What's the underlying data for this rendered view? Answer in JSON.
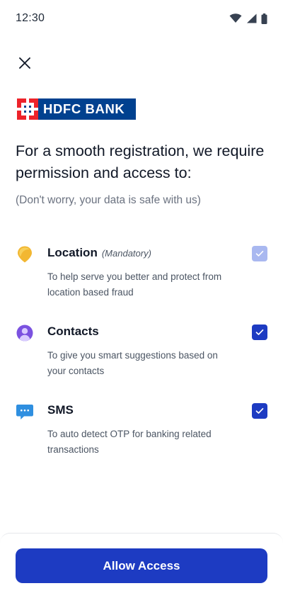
{
  "status_bar": {
    "time": "12:30",
    "icons": [
      "wifi-icon",
      "signal-icon",
      "battery-icon"
    ]
  },
  "header": {
    "close_icon": "close-icon"
  },
  "logo": {
    "text": "HDFC BANK",
    "colors": {
      "background": "#00418f",
      "mark": "#ed232a"
    }
  },
  "content": {
    "headline": "For a smooth registration, we require permission and access to:",
    "subline": "(Don't worry, your data is safe with us)"
  },
  "permissions": [
    {
      "icon": "location-pin-icon",
      "title": "Location",
      "note": "(Mandatory)",
      "description": "To help serve you better and protect from location based fraud",
      "checked": true,
      "disabled": true
    },
    {
      "icon": "contact-person-icon",
      "title": "Contacts",
      "note": "",
      "description": "To give you smart suggestions based on your contacts",
      "checked": true,
      "disabled": false
    },
    {
      "icon": "chat-bubble-icon",
      "title": "SMS",
      "note": "",
      "description": "To auto detect OTP for banking related transactions",
      "checked": true,
      "disabled": false
    }
  ],
  "footer": {
    "allow_label": "Allow Access"
  },
  "colors": {
    "primary": "#1d3bc2",
    "checkbox_disabled": "#a9b8f0",
    "text_primary": "#111827",
    "text_secondary": "#4b5563"
  }
}
